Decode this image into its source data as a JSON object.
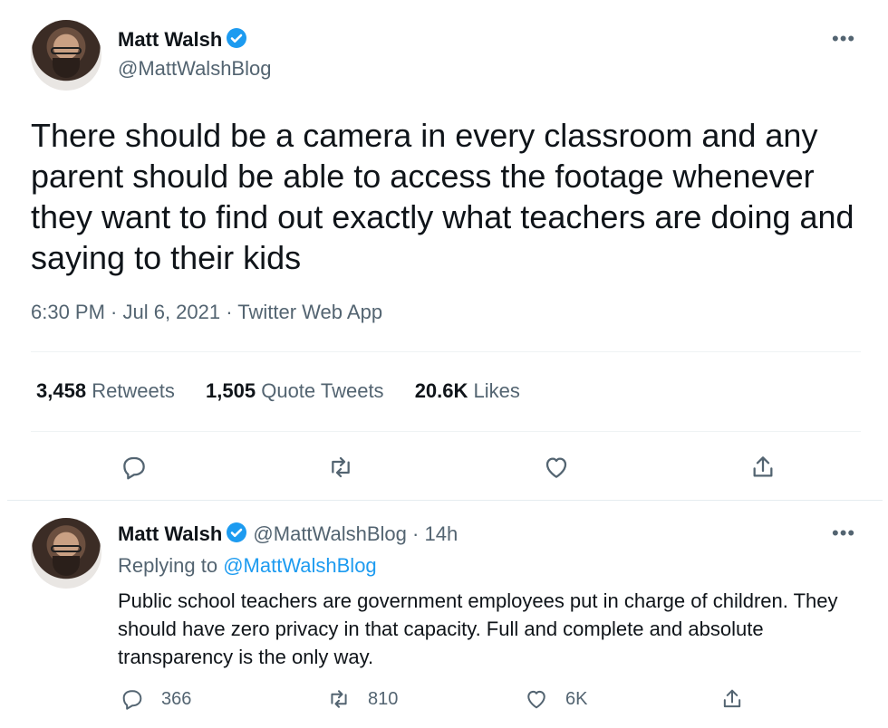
{
  "main_tweet": {
    "author_name": "Matt Walsh",
    "author_handle": "@MattWalshBlog",
    "more_label": "•••",
    "text": "There should be a camera in every classroom and any parent should be able to access the footage whenever they want to find out exactly what teachers are doing and saying to their kids",
    "meta": "6:30 PM · Jul 6, 2021 · Twitter Web App",
    "stats": {
      "retweets_count": "3,458",
      "retweets_label": "Retweets",
      "quotes_count": "1,505",
      "quotes_label": "Quote Tweets",
      "likes_count": "20.6K",
      "likes_label": "Likes"
    },
    "actions": [
      "reply-icon",
      "retweet-icon",
      "like-icon",
      "share-icon"
    ]
  },
  "reply_tweet": {
    "author_name": "Matt Walsh",
    "author_handle": "@MattWalshBlog",
    "separator": "·",
    "time": "14h",
    "more_label": "•••",
    "replying_prefix": "Replying to",
    "replying_to": "@MattWalshBlog",
    "text": "Public school teachers are government employees put in charge of children. They should have zero privacy in that capacity. Full and complete and absolute transparency is the only way.",
    "reply_count": "366",
    "retweet_count": "810",
    "like_count": "6K"
  },
  "colors": {
    "accent": "#1d9bf0",
    "text": "#0f1419",
    "muted": "#536471",
    "divider": "#eff3f4"
  }
}
